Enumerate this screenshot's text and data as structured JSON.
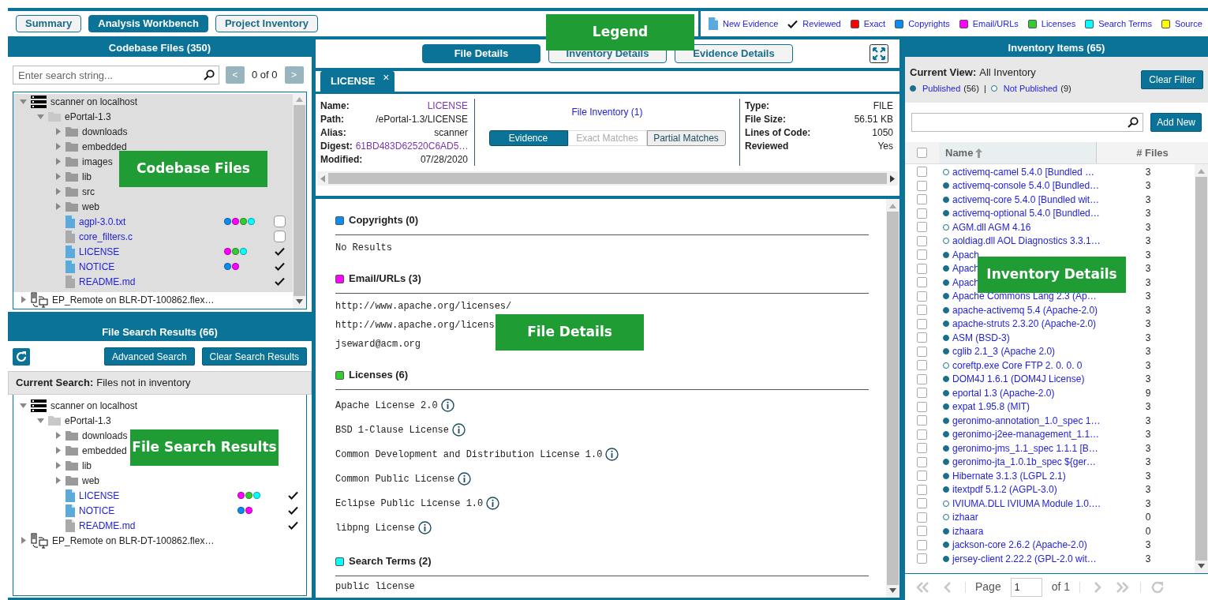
{
  "nav_tabs": [
    {
      "label": "Summary",
      "selected": false
    },
    {
      "label": "Analysis Workbench",
      "selected": true
    },
    {
      "label": "Project Inventory",
      "selected": false
    }
  ],
  "legend": {
    "callout": "Legend",
    "items": [
      {
        "kind": "file",
        "label": "New Evidence"
      },
      {
        "kind": "check",
        "label": "Reviewed"
      },
      {
        "kind": "swatch",
        "label": "Exact",
        "color": "#ff0000"
      },
      {
        "kind": "swatch",
        "label": "Copyrights",
        "color": "#0a8cf0"
      },
      {
        "kind": "swatch",
        "label": "Email/URLs",
        "color": "#ff00ff"
      },
      {
        "kind": "swatch",
        "label": "Licenses",
        "color": "#33cc33"
      },
      {
        "kind": "swatch",
        "label": "Search Terms",
        "color": "#00ffff"
      },
      {
        "kind": "swatch",
        "label": "Source",
        "color": "#ffff00"
      }
    ]
  },
  "codebase_files": {
    "title": "Codebase Files (350)",
    "callout": "Codebase Files",
    "search_placeholder": "Enter search string...",
    "prev": "<",
    "pager": "0 of 0",
    "next": ">",
    "tree": [
      {
        "kind": "server",
        "label": "scanner on localhost",
        "expanded": true,
        "selected": true,
        "children": [
          {
            "kind": "folder",
            "label": "ePortal-1.3",
            "expanded": true,
            "children": [
              {
                "kind": "folder",
                "label": "downloads",
                "expanded": false
              },
              {
                "kind": "folder",
                "label": "embedded",
                "expanded": false
              },
              {
                "kind": "folder",
                "label": "images",
                "expanded": false
              },
              {
                "kind": "folder",
                "label": "lib",
                "expanded": false
              },
              {
                "kind": "folder",
                "label": "src",
                "expanded": false
              },
              {
                "kind": "folder",
                "label": "web",
                "expanded": false
              },
              {
                "kind": "file",
                "label": "agpl-3.0.txt",
                "new_evidence": true,
                "reviewed": false,
                "dots": [
                  {
                    "color": "#0a8cf0"
                  },
                  {
                    "color": "#ff00ff"
                  },
                  {
                    "color": "#33cc33"
                  },
                  {
                    "color": "#00ffff"
                  }
                ]
              },
              {
                "kind": "file",
                "label": "core_filters.c",
                "new_evidence": false,
                "reviewed": false
              },
              {
                "kind": "file",
                "label": "LICENSE",
                "new_evidence": true,
                "reviewed": true,
                "dots": [
                  {
                    "color": "#ff00ff"
                  },
                  {
                    "color": "#33cc33"
                  },
                  {
                    "color": "#00ffff"
                  }
                ]
              },
              {
                "kind": "file",
                "label": "NOTICE",
                "new_evidence": true,
                "reviewed": true,
                "dots": [
                  {
                    "color": "#0a8cf0"
                  },
                  {
                    "color": "#ff00ff"
                  }
                ]
              },
              {
                "kind": "file",
                "label": "README.md",
                "new_evidence": false,
                "reviewed": true
              }
            ]
          }
        ]
      },
      {
        "kind": "remote",
        "label": "EP_Remote on BLR-DT-100862.flex…",
        "expanded": false,
        "selected": false
      }
    ]
  },
  "file_search_results": {
    "title": "File Search Results (66)",
    "callout": "File Search Results",
    "buttons": [
      "Advanced Search",
      "Clear Search Results"
    ],
    "current_search_label": "Current Search:",
    "current_search_value": "Files not in inventory",
    "tree": [
      {
        "kind": "server",
        "label": "scanner on localhost",
        "expanded": true,
        "selected": false,
        "children": [
          {
            "kind": "folder",
            "label": "ePortal-1.3",
            "expanded": true,
            "children": [
              {
                "kind": "folder",
                "label": "downloads",
                "expanded": false
              },
              {
                "kind": "folder",
                "label": "embedded",
                "expanded": false
              },
              {
                "kind": "folder",
                "label": "lib",
                "expanded": false
              },
              {
                "kind": "folder",
                "label": "web",
                "expanded": false
              },
              {
                "kind": "file",
                "label": "LICENSE",
                "new_evidence": true,
                "reviewed": true,
                "dots": [
                  {
                    "color": "#ff00ff"
                  },
                  {
                    "color": "#33cc33"
                  },
                  {
                    "color": "#00ffff"
                  }
                ]
              },
              {
                "kind": "file",
                "label": "NOTICE",
                "new_evidence": true,
                "reviewed": true,
                "dots": [
                  {
                    "color": "#0a8cf0"
                  },
                  {
                    "color": "#ff00ff"
                  }
                ]
              },
              {
                "kind": "file",
                "label": "README.md",
                "new_evidence": false,
                "reviewed": true
              }
            ]
          }
        ]
      },
      {
        "kind": "remote",
        "label": "EP_Remote on BLR-DT-100862.flex…",
        "expanded": false,
        "selected": false
      }
    ]
  },
  "file_details": {
    "callout": "File Details",
    "tabs": [
      {
        "label": "File Details",
        "selected": true
      },
      {
        "label": "Inventory Details",
        "selected": false
      },
      {
        "label": "Evidence Details",
        "selected": false
      }
    ],
    "file_tab": {
      "label": "LICENSE",
      "close": "×"
    },
    "info_left": [
      {
        "label": "Name:",
        "value": "LICENSE",
        "link": true
      },
      {
        "label": "Path:",
        "value": "/ePortal-1.3/LICENSE",
        "link": false
      },
      {
        "label": "Alias:",
        "value": "scanner",
        "link": false
      },
      {
        "label": "Digest:",
        "value": "61BD483D62520C6AD5…",
        "link": true
      },
      {
        "label": "Modified:",
        "value": "07/28/2020",
        "link": false
      }
    ],
    "file_inventory": "File Inventory (1)",
    "evidence_tabs": [
      {
        "label": "Evidence",
        "selected": true,
        "disabled": false
      },
      {
        "label": "Exact Matches",
        "selected": false,
        "disabled": true
      },
      {
        "label": "Partial Matches",
        "selected": false,
        "disabled": false
      }
    ],
    "info_right": [
      {
        "label": "Type:",
        "value": "FILE"
      },
      {
        "label": "File Size:",
        "value": "56.51 KB"
      },
      {
        "label": "Lines of Code:",
        "value": "1050"
      },
      {
        "label": "Reviewed",
        "value": "Yes"
      }
    ],
    "sections": [
      {
        "title": "Copyrights (0)",
        "color": "#0a8cf0",
        "items": [
          {
            "text": "No Results",
            "info": false
          }
        ]
      },
      {
        "title": "Email/URLs (3)",
        "color": "#ff00ff",
        "items": [
          {
            "text": "http://www.apache.org/licenses/",
            "info": false
          },
          {
            "text": "http://www.apache.org/licens",
            "info": false
          },
          {
            "text": "jseward@acm.org",
            "info": false
          }
        ]
      },
      {
        "title": "Licenses (6)",
        "color": "#33cc33",
        "items": [
          {
            "text": "Apache License 2.0",
            "info": true
          },
          {
            "text": "BSD 1-Clause License",
            "info": true
          },
          {
            "text": "Common Development and Distribution License 1.0",
            "info": true
          },
          {
            "text": "Common Public License",
            "info": true
          },
          {
            "text": "Eclipse Public License 1.0",
            "info": true
          },
          {
            "text": "libpng License",
            "info": true
          }
        ]
      },
      {
        "title": "Search Terms (2)",
        "color": "#00ffff",
        "items": [
          {
            "text": "public license",
            "info": false
          }
        ]
      }
    ]
  },
  "inventory": {
    "title": "Inventory Items (65)",
    "callout": "Inventory Details",
    "current_view_label": "Current View:",
    "current_view_value": "All Inventory",
    "filters": [
      {
        "label": "Published",
        "count": "(56)",
        "published": true
      },
      {
        "label": "Not Published",
        "count": "(9)",
        "published": false
      }
    ],
    "filter_separator": "|",
    "clear_filter": "Clear Filter",
    "add_new": "Add New",
    "columns": [
      "Name",
      "# Files"
    ],
    "header_checked": false,
    "rows": [
      {
        "name": "activemq-camel 5.4.0 [Bundled …",
        "files": "3",
        "published": false,
        "checked": false
      },
      {
        "name": "activemq-console 5.4.0 [Bundled…",
        "files": "3",
        "published": true,
        "checked": false
      },
      {
        "name": "activemq-core 5.4.0 [Bundled wit…",
        "files": "3",
        "published": true,
        "checked": false
      },
      {
        "name": "activemq-optional 5.4.0 [Bundled…",
        "files": "3",
        "published": true,
        "checked": false
      },
      {
        "name": "AGM.dll AGM 4.16",
        "files": "3",
        "published": false,
        "checked": false
      },
      {
        "name": "aoldiag.dll AOL Diagnostics 3.3.1…",
        "files": "3",
        "published": false,
        "checked": false
      },
      {
        "name": "Apach",
        "files": "3",
        "published": true,
        "checked": false
      },
      {
        "name": "Apach",
        "files": "3",
        "published": true,
        "checked": false
      },
      {
        "name": "Apach",
        "files": "3",
        "published": true,
        "checked": false
      },
      {
        "name": "Apache Commons Lang 2.3 (Ap…",
        "files": "3",
        "published": true,
        "checked": false
      },
      {
        "name": "apache-activemq 5.4 (Apache-2.0)",
        "files": "3",
        "published": true,
        "checked": false
      },
      {
        "name": "apache-struts 2.3.20 (Apache-2.0)",
        "files": "3",
        "published": true,
        "checked": false
      },
      {
        "name": "ASM (BSD-3)",
        "files": "3",
        "published": true,
        "checked": false
      },
      {
        "name": "cglib 2.1_3 (Apache 2.0)",
        "files": "3",
        "published": true,
        "checked": false
      },
      {
        "name": "coreftp.exe Core FTP 2. 0. 0. 0",
        "files": "3",
        "published": false,
        "checked": false
      },
      {
        "name": "DOM4J 1.6.1 (DOM4J License)",
        "files": "3",
        "published": true,
        "checked": false
      },
      {
        "name": "eportal 1.3 (Apache-2.0)",
        "files": "9",
        "published": true,
        "checked": false
      },
      {
        "name": "expat 1.95.8 (MIT)",
        "files": "3",
        "published": true,
        "checked": false
      },
      {
        "name": "geronimo-annotation_1.0_spec 1…",
        "files": "3",
        "published": true,
        "checked": false
      },
      {
        "name": "geronimo-j2ee-management_1.1…",
        "files": "3",
        "published": true,
        "checked": false
      },
      {
        "name": "geronimo-jms_1.1_spec 1.1.1 [B…",
        "files": "3",
        "published": true,
        "checked": false
      },
      {
        "name": "geronimo-jta_1.0.1b_spec ${ger…",
        "files": "3",
        "published": true,
        "checked": false
      },
      {
        "name": "Hibernate 3.1.3 (LGPL 2.1)",
        "files": "3",
        "published": true,
        "checked": false
      },
      {
        "name": "itextpdf 5.1.2 (AGPL-3.0)",
        "files": "3",
        "published": true,
        "checked": false
      },
      {
        "name": "IVIUMA.DLL IVIUMA Module 1.0.…",
        "files": "3",
        "published": false,
        "checked": false
      },
      {
        "name": "izhaar",
        "files": "0",
        "published": false,
        "checked": false
      },
      {
        "name": "izhaara",
        "files": "0",
        "published": true,
        "checked": false
      },
      {
        "name": "jackson-core 2.6.2 (Apache-2.0)",
        "files": "3",
        "published": true,
        "checked": false
      },
      {
        "name": "jersey-client 2.22.2 (GPL-2.0 wit…",
        "files": "3",
        "published": true,
        "checked": false
      }
    ],
    "page_label": "Page",
    "page": "1",
    "page_of": "of 1"
  }
}
